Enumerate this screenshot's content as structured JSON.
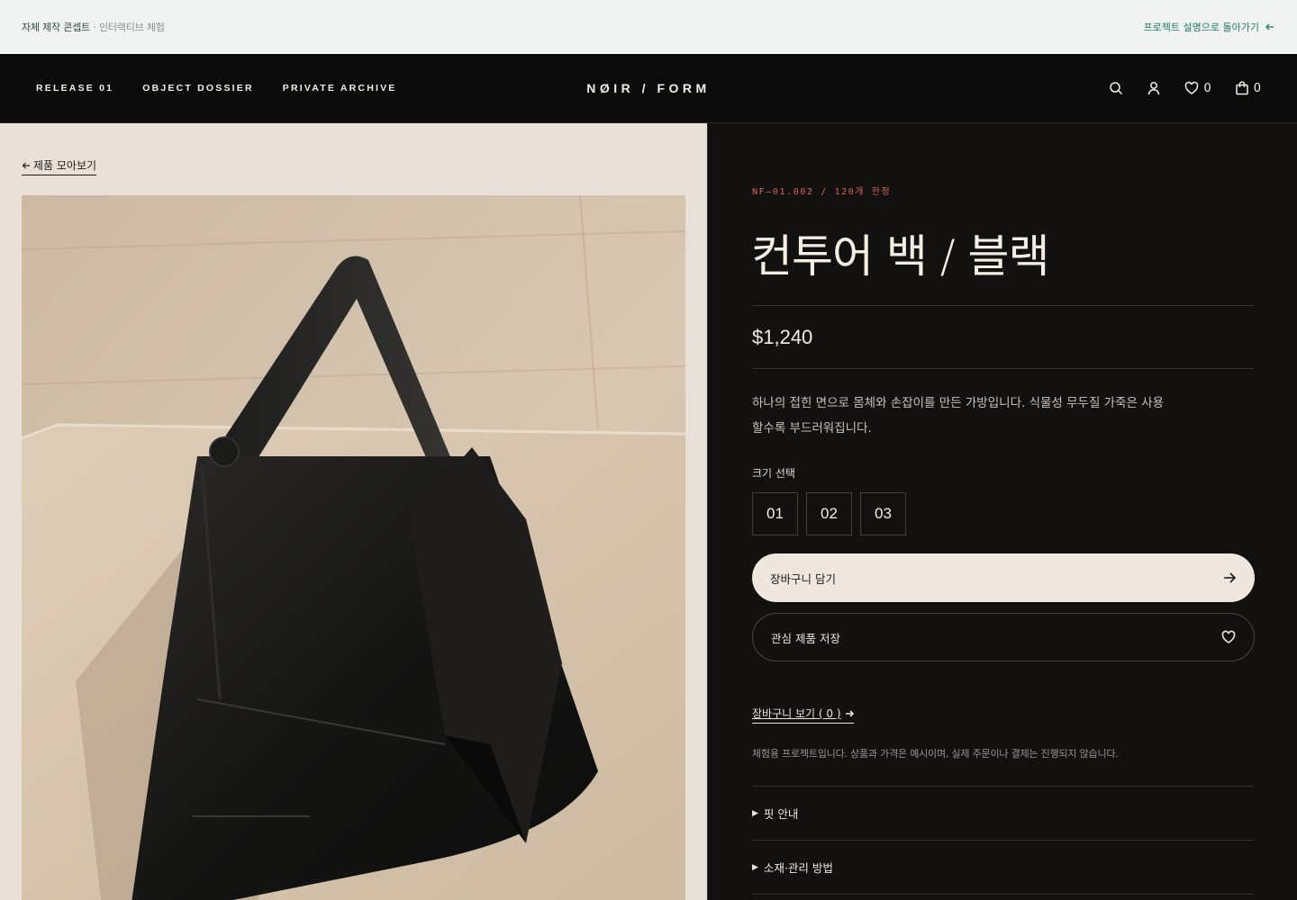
{
  "notice": {
    "left_main": "자체 제작 콘셉트",
    "left_sep": "·",
    "left_sub": "인터랙티브 체험",
    "right_link": "프로젝트 설명으로 돌아가기"
  },
  "header": {
    "nav": [
      "RELEASE 01",
      "OBJECT DOSSIER",
      "PRIVATE ARCHIVE"
    ],
    "brand": "NØIR / FORM",
    "wishlist_count": "0",
    "cart_count": "0"
  },
  "left": {
    "back_link": "제품 모아보기"
  },
  "product": {
    "sku": "NF—01.002 / 120개 한정",
    "title": "컨투어 백 / 블랙",
    "price": "$1,240",
    "description": "하나의 접힌 면으로 몸체와 손잡이를 만든 가방입니다. 식물성 무두질 가죽은 사용할수록 부드러워집니다.",
    "size_label": "크기 선택",
    "sizes": [
      "01",
      "02",
      "03"
    ],
    "add_to_cart": "장바구니 담기",
    "save_wishlist": "관심 제품 저장",
    "view_cart": "장바구니 보기 ( 0 )",
    "disclaimer": "체험용 프로젝트입니다. 상품과 가격은 예시이며, 실제 주문이나 결제는 진행되지 않습니다.",
    "accordions": [
      "핏 안내",
      "소재·관리 방법"
    ]
  },
  "colors": {
    "accent_sku": "#d6635a",
    "notice_link": "#1f7a66",
    "panel_dark": "#121110",
    "panel_light": "#e9e1d8"
  }
}
